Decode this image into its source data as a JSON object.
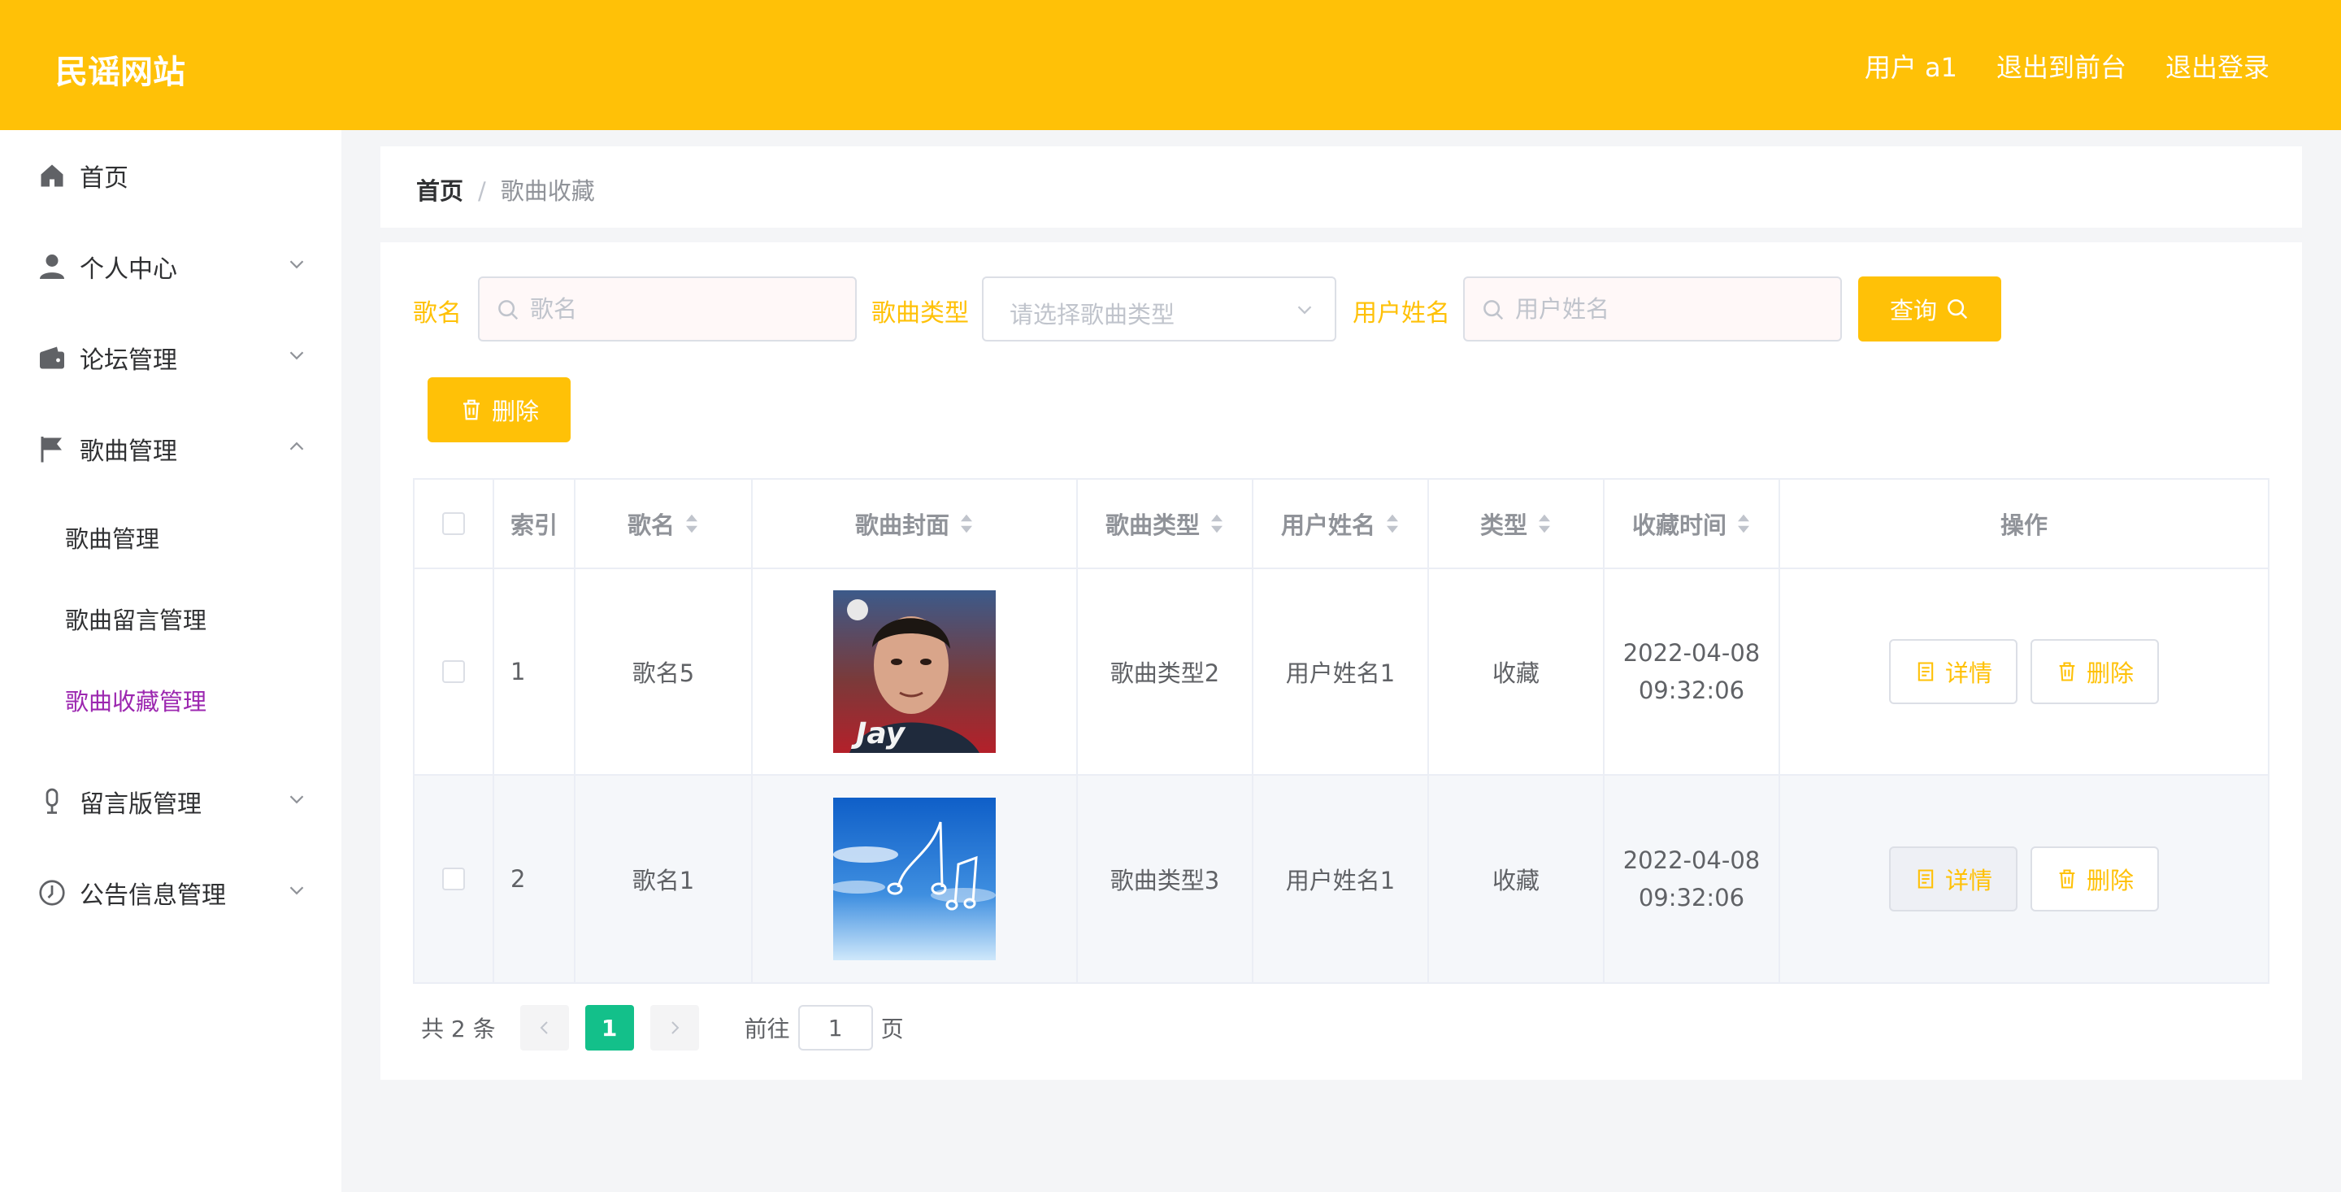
{
  "header": {
    "brand": "民谣网站",
    "user_label": "用户 a1",
    "to_front_label": "退出到前台",
    "logout_label": "退出登录"
  },
  "sidebar": {
    "items": [
      {
        "label": "首页",
        "icon": "home-icon"
      },
      {
        "label": "个人中心",
        "icon": "user-icon"
      },
      {
        "label": "论坛管理",
        "icon": "wallet-icon"
      },
      {
        "label": "歌曲管理",
        "icon": "flag-icon",
        "expanded": true,
        "children": [
          "歌曲管理",
          "歌曲留言管理",
          "歌曲收藏管理"
        ]
      },
      {
        "label": "留言版管理",
        "icon": "microphone-icon"
      },
      {
        "label": "公告信息管理",
        "icon": "notice-icon"
      }
    ],
    "active_child": "歌曲收藏管理"
  },
  "breadcrumb": {
    "home": "首页",
    "separator": "/",
    "current": "歌曲收藏"
  },
  "filters": {
    "song_name_label": "歌名",
    "song_name_placeholder": "歌名",
    "song_type_label": "歌曲类型",
    "song_type_placeholder": "请选择歌曲类型",
    "user_name_label": "用户姓名",
    "user_name_placeholder": "用户姓名",
    "query_label": "查询"
  },
  "toolbar": {
    "delete_label": "删除"
  },
  "table": {
    "columns": [
      "索引",
      "歌名",
      "歌曲封面",
      "歌曲类型",
      "用户姓名",
      "类型",
      "收藏时间",
      "操作"
    ],
    "rows": [
      {
        "index": "1",
        "song_name": "歌名5",
        "cover": "jay-album-cover",
        "song_type": "歌曲类型2",
        "user_name": "用户姓名1",
        "type": "收藏",
        "date": "2022-04-08",
        "time": "09:32:06"
      },
      {
        "index": "2",
        "song_name": "歌名1",
        "cover": "sky-music-notes-cover",
        "song_type": "歌曲类型3",
        "user_name": "用户姓名1",
        "type": "收藏",
        "date": "2022-04-08",
        "time": "09:32:06"
      }
    ],
    "detail_label": "详情",
    "delete_label": "删除"
  },
  "pagination": {
    "total_text": "共 2 条",
    "current_page": "1",
    "goto_prefix": "前往",
    "goto_value": "1",
    "goto_suffix": "页"
  },
  "colors": {
    "accent": "#ffc107",
    "active_menu": "#9c27b0",
    "pager_current": "#13c08a"
  }
}
